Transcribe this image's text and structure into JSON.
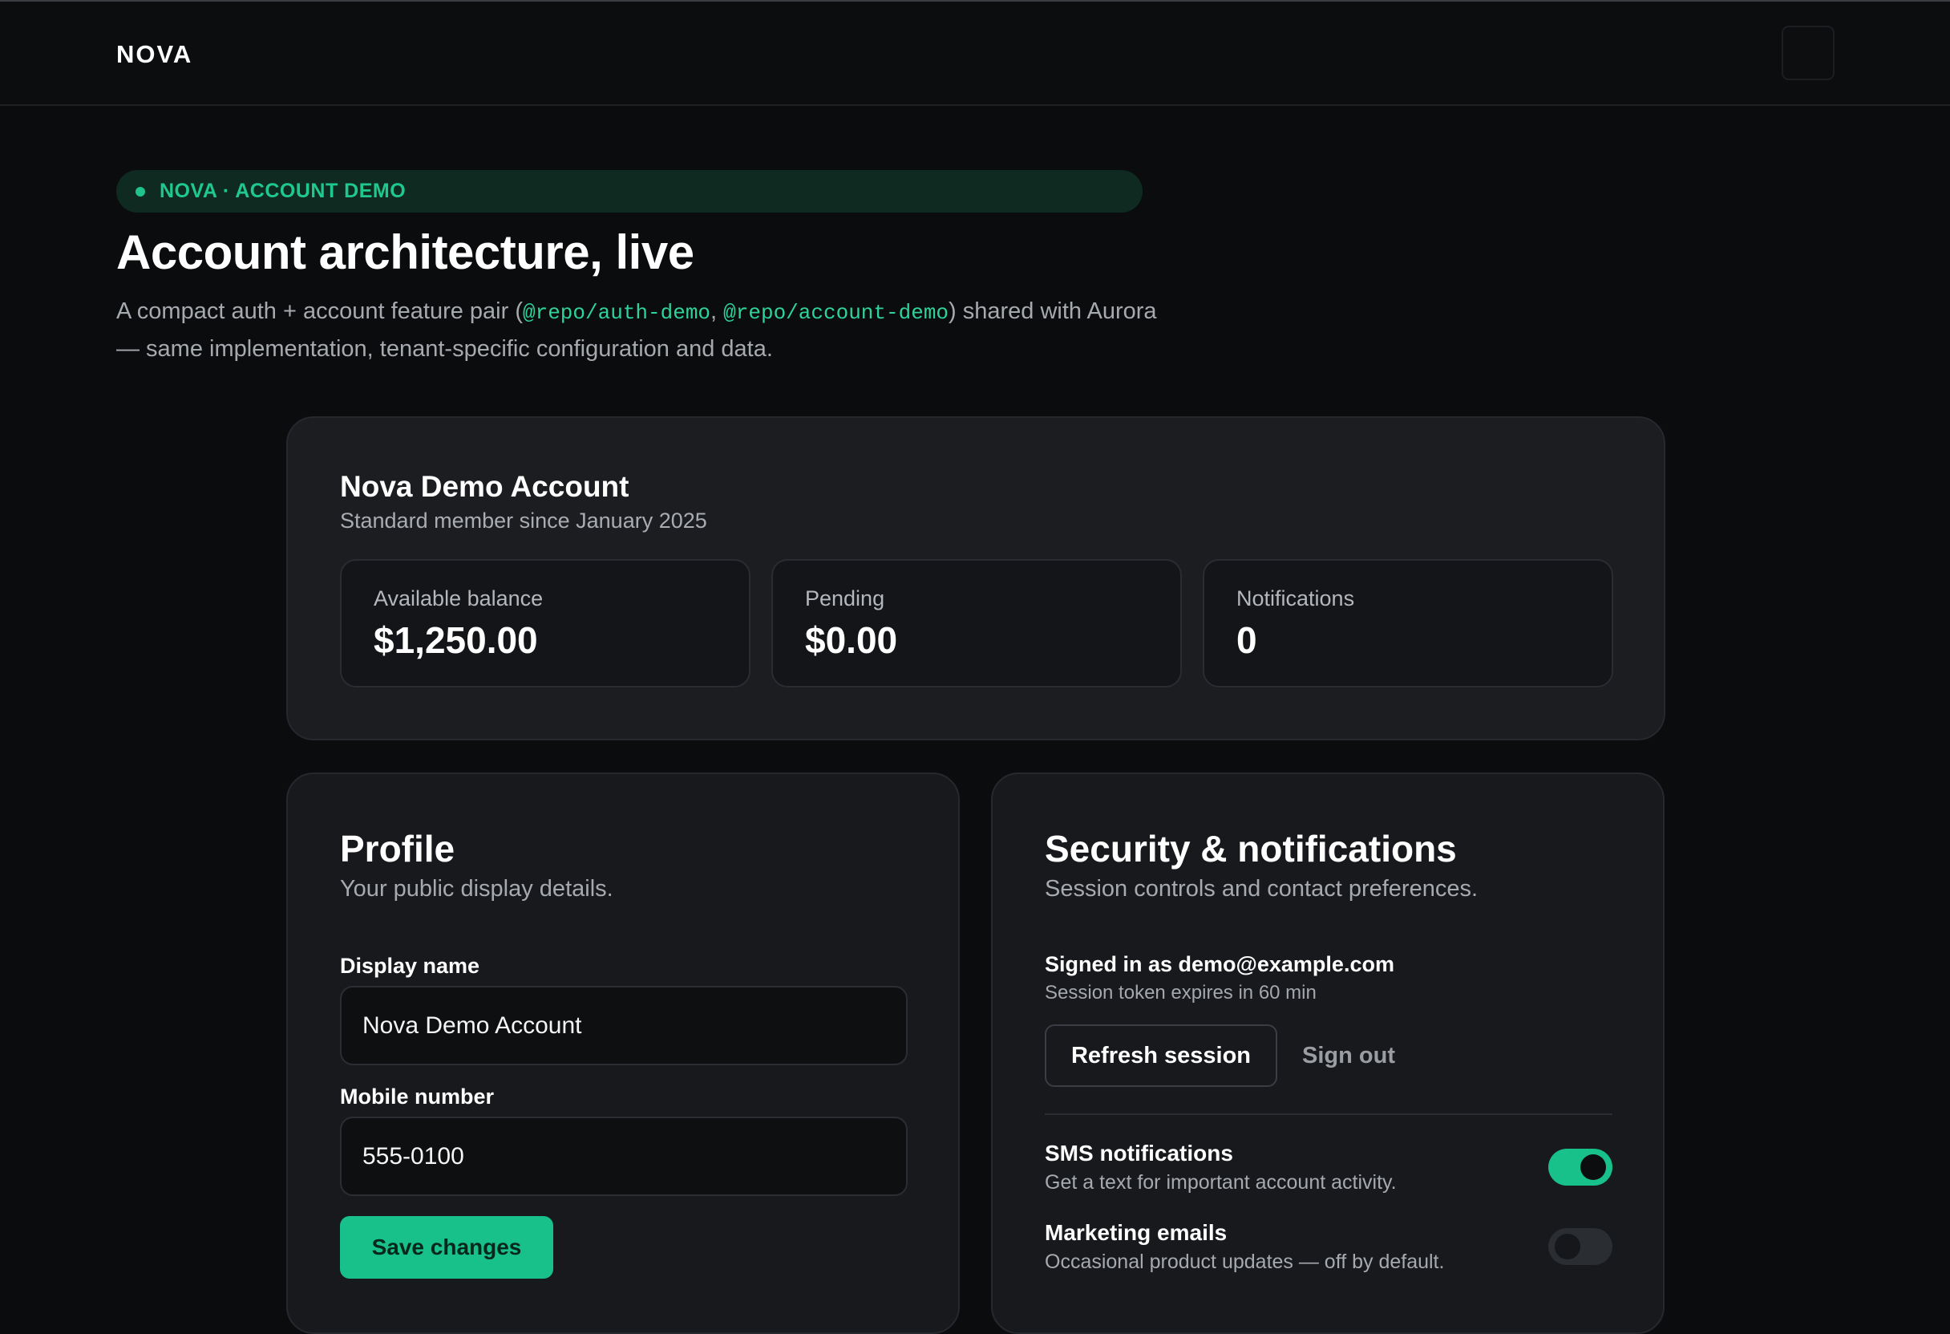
{
  "nav": {
    "brand": "NOVA"
  },
  "hero": {
    "badge": "NOVA · ACCOUNT DEMO",
    "title": "Account architecture, live",
    "desc_part1": "A compact auth + account feature pair (",
    "code1": "@repo/auth-demo",
    "desc_sep": ", ",
    "code2": "@repo/account-demo",
    "desc_part2": ") shared with Aurora — same implementation, tenant-specific configuration and data."
  },
  "account": {
    "name": "Nova Demo Account",
    "since": "Standard member since January 2025",
    "stats": [
      {
        "label": "Available balance",
        "value": "$1,250.00"
      },
      {
        "label": "Pending",
        "value": "$0.00"
      },
      {
        "label": "Notifications",
        "value": "0"
      }
    ]
  },
  "profile": {
    "title": "Profile",
    "subtitle": "Your public display details.",
    "display_name_label": "Display name",
    "display_name_value": "Nova Demo Account",
    "mobile_label": "Mobile number",
    "mobile_value": "555-0100",
    "save_label": "Save changes"
  },
  "security": {
    "title": "Security & notifications",
    "subtitle": "Session controls and contact preferences.",
    "signed_in": "Signed in as demo@example.com",
    "token_expiry": "Session token expires in 60 min",
    "refresh_label": "Refresh session",
    "signout_label": "Sign out",
    "preferences": [
      {
        "title": "SMS notifications",
        "desc": "Get a text for important account activity.",
        "enabled": true
      },
      {
        "title": "Marketing emails",
        "desc": "Occasional product updates — off by default.",
        "enabled": false
      }
    ]
  },
  "colors": {
    "accent": "#17c189",
    "background": "#0b0c0e",
    "card": "#17191d"
  }
}
